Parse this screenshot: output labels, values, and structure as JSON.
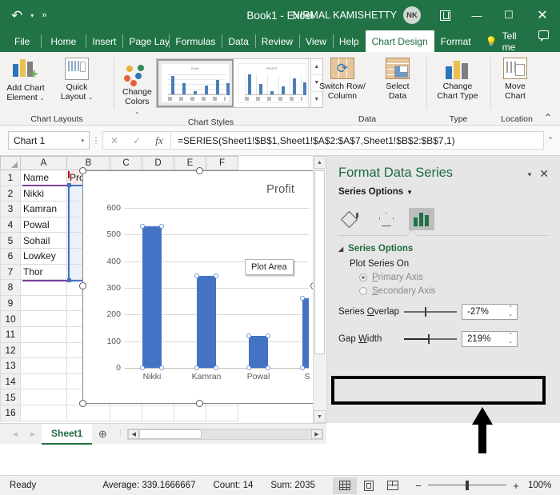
{
  "titlebar": {
    "undo_icon": "undo-arrow-icon",
    "undo_caret": "▾",
    "more_icon": "»",
    "title": "Book1  -  Excel",
    "user_name": "NIRMAL KAMISHETTY",
    "user_initials": "NK",
    "ribbon_display_icon": "ribbon-display-options-icon",
    "minimize": "—",
    "maximize": "☐",
    "close": "✕",
    "bg_color": "#217346"
  },
  "tabs": [
    {
      "label": "File",
      "active": false
    },
    {
      "label": "Home",
      "active": false
    },
    {
      "label": "Insert",
      "active": false
    },
    {
      "label": "Page Layc",
      "active": false
    },
    {
      "label": "Formulas",
      "active": false
    },
    {
      "label": "Data",
      "active": false
    },
    {
      "label": "Review",
      "active": false
    },
    {
      "label": "View",
      "active": false
    },
    {
      "label": "Help",
      "active": false
    },
    {
      "label": "Chart Design",
      "active": true
    },
    {
      "label": "Format",
      "active": false
    }
  ],
  "tellme": {
    "bulb": "💡",
    "label": "Tell me",
    "comment_icon": "comment-icon"
  },
  "ribbon": {
    "groups": [
      {
        "label": "Chart Layouts",
        "buttons": [
          {
            "name": "add-chart-element",
            "line1": "Add Chart",
            "line2": "Element",
            "caret": "⌄"
          },
          {
            "name": "quick-layout",
            "line1": "Quick",
            "line2": "Layout",
            "caret": "⌄"
          }
        ]
      },
      {
        "label": "Chart Styles",
        "buttons": [
          {
            "name": "change-colors",
            "line1": "Change",
            "line2": "Colors",
            "caret": "⌄"
          }
        ],
        "gallery": {
          "scroll_up": "▲",
          "scroll_down": "▼",
          "scroll_more": "▼",
          "thumbs": [
            {
              "title": "Profit",
              "selected": true,
              "bars": [
                22,
                14,
                4,
                11,
                18,
                14
              ]
            },
            {
              "title": "PROFIT",
              "selected": false,
              "bars": [
                23,
                13,
                4,
                10,
                19,
                15
              ]
            }
          ]
        }
      },
      {
        "label": "Data",
        "buttons": [
          {
            "name": "switch-row-column",
            "line1": "Switch Row/",
            "line2": "Column",
            "caret": ""
          },
          {
            "name": "select-data",
            "line1": "Select",
            "line2": "Data",
            "caret": ""
          }
        ]
      },
      {
        "label": "Type",
        "buttons": [
          {
            "name": "change-chart-type",
            "line1": "Change",
            "line2": "Chart Type",
            "caret": ""
          }
        ]
      },
      {
        "label": "Location",
        "buttons": [
          {
            "name": "move-chart",
            "line1": "Move",
            "line2": "Chart",
            "caret": ""
          }
        ]
      }
    ],
    "collapse_icon": "⌃"
  },
  "formulabar": {
    "namebox_value": "Chart 1",
    "namebox_caret": "▾",
    "dots": "⋮",
    "cancel_icon": "✕",
    "enter_icon": "✓",
    "fx_icon": "fx",
    "formula": "=SERIES(Sheet1!$B$1,Sheet1!$A$2:$A$7,Sheet1!$B$2:$B$7,1)",
    "expand_icon": "⌃"
  },
  "grid": {
    "corner_icon": "select-all-icon",
    "columns": [
      "A",
      "B",
      "C",
      "D",
      "E",
      "F"
    ],
    "rows": [
      "1",
      "2",
      "3",
      "4",
      "5",
      "6",
      "7",
      "8",
      "9",
      "10",
      "11",
      "12",
      "13",
      "14",
      "15",
      "16"
    ],
    "cells": {
      "A1": "Name",
      "B1": "Profit",
      "A2": "Nikki",
      "A3": "Kamran",
      "A4": "Powal",
      "A5": "Sohail",
      "A6": "Lowkey",
      "A7": "Thor"
    }
  },
  "chart_data": {
    "type": "bar",
    "title": "Profit",
    "categories": [
      "Nikki",
      "Kamran",
      "Powal",
      "Sohail",
      "Lowkey",
      "Thor"
    ],
    "values": [
      530,
      345,
      120,
      262,
      null,
      null
    ],
    "visible_categories": [
      "Nikki",
      "Kamran",
      "Powal",
      "S"
    ],
    "xlabel": "",
    "ylabel": "",
    "ylim": [
      0,
      600
    ],
    "yticks": [
      0,
      100,
      200,
      300,
      400,
      500,
      600
    ],
    "grid": true,
    "legend": "none",
    "series_name": "Profit",
    "bar_color": "#4472c4",
    "selected": true,
    "tooltip": "Plot Area"
  },
  "pane": {
    "title": "Format Data Series",
    "caret_icon": "▾",
    "close_icon": "✕",
    "subtitle": "Series Options",
    "subtitle_caret": "▼",
    "tabs": [
      {
        "name": "fill-line-tab",
        "icon": "paint-bucket-icon",
        "active": false
      },
      {
        "name": "effects-tab",
        "icon": "pentagon-icon",
        "active": false
      },
      {
        "name": "series-options-tab",
        "icon": "bar-chart-icon",
        "active": true
      }
    ],
    "section_title": "Series Options",
    "section_tri": "◢",
    "plot_series_on_label": "Plot Series On",
    "primary_axis": "Primary Axis",
    "secondary_axis": "Secondary Axis",
    "series_overlap_label": "Series Overlap",
    "series_overlap_value": "-27%",
    "gap_width_label": "Gap Width",
    "gap_width_value": "219%",
    "spin_up": "⌃",
    "spin_down": "⌄",
    "highlight_color": "#000000"
  },
  "sheettabs": {
    "prev": "◂",
    "next": "▸",
    "tabs": [
      "Sheet1"
    ],
    "add_icon": "⊕",
    "dots": "⋮",
    "hs_left": "◀",
    "hs_right": "▶"
  },
  "statusbar": {
    "mode": "Ready",
    "average": "Average: 339.1666667",
    "count": "Count: 14",
    "sum": "Sum: 2035",
    "views": [
      {
        "name": "normal-view",
        "icon": "normal-view-icon",
        "active": true
      },
      {
        "name": "page-layout-view",
        "icon": "page-layout-icon",
        "active": false
      },
      {
        "name": "page-break-view",
        "icon": "page-break-icon",
        "active": false
      }
    ],
    "zoom_minus": "−",
    "zoom_plus": "+",
    "zoom_level": "100%"
  }
}
